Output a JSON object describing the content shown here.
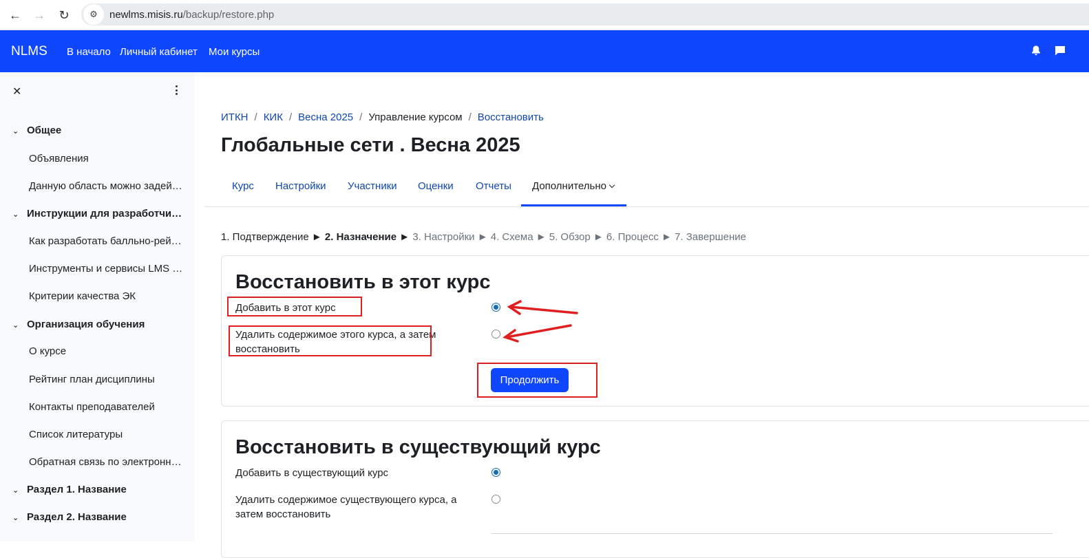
{
  "browser": {
    "url_domain": "newlms.misis.ru",
    "url_path": "/backup/restore.php",
    "back_icon": "arrow-left-icon",
    "forward_icon": "arrow-right-icon",
    "reload_icon": "reload-icon",
    "site_info_icon": "tune-icon"
  },
  "navbar": {
    "brand": "NLMS",
    "links": [
      "В начало",
      "Личный кабинет",
      "Мои курсы"
    ],
    "icons": [
      "bell-icon",
      "chat-icon"
    ],
    "color": "#0f47ff"
  },
  "sidebar": {
    "items": [
      {
        "type": "section",
        "label": "Общее"
      },
      {
        "type": "item",
        "label": "Объявления"
      },
      {
        "type": "item",
        "label": "Данную область можно задействовать"
      },
      {
        "type": "section",
        "label": "Инструкции для разработчиков"
      },
      {
        "type": "item",
        "label": "Как разработать балльно-рейтинговую систему"
      },
      {
        "type": "item",
        "label": "Инструменты и сервисы LMS Canvas"
      },
      {
        "type": "item",
        "label": "Критерии качества ЭК"
      },
      {
        "type": "section",
        "label": "Организация обучения"
      },
      {
        "type": "item",
        "label": "О курсе"
      },
      {
        "type": "item",
        "label": "Рейтинг план дисциплины"
      },
      {
        "type": "item",
        "label": "Контакты преподавателей"
      },
      {
        "type": "item",
        "label": "Список литературы"
      },
      {
        "type": "item",
        "label": "Обратная связь по электронному курсу"
      },
      {
        "type": "section",
        "label": "Раздел 1. Название"
      },
      {
        "type": "section",
        "label": "Раздел 2. Название"
      }
    ]
  },
  "breadcrumb": [
    "ИТКН",
    "КИК",
    "Весна 2025",
    "Управление курсом",
    "Восстановить"
  ],
  "page_title": "Глобальные сети . Весна 2025",
  "tabs": [
    "Курс",
    "Настройки",
    "Участники",
    "Оценки",
    "Отчеты",
    "Дополнительно"
  ],
  "steps": {
    "s1": "1. Подтверждение ►",
    "s2": "2. Назначение",
    "arrow2": "►",
    "rest": "3. Настройки ► 4. Схема ► 5. Обзор ► 6. Процесс ► 7. Завершение"
  },
  "card1": {
    "heading": "Восстановить в этот курс",
    "option1": "Добавить в этот курс",
    "option1_checked": true,
    "option2": "Удалить содержимое этого курса, а затем восстановить",
    "option2_checked": false,
    "continue": "Продолжить"
  },
  "card2": {
    "heading": "Восстановить в существующий курс",
    "option1": "Добавить в существующий курс",
    "option1_checked": true,
    "option2": "Удалить содержимое существующего курса, а затем восстановить",
    "option2_checked": false
  },
  "annotation_color": "#e02020"
}
